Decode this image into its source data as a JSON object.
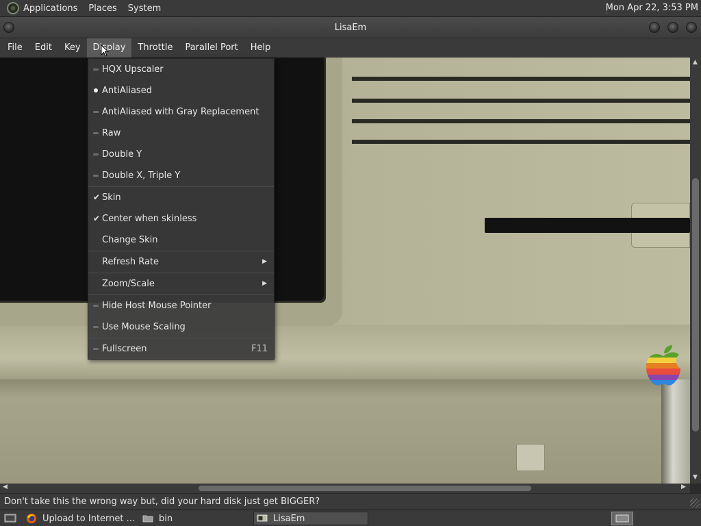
{
  "top_panel": {
    "menus": [
      "Applications",
      "Places",
      "System"
    ],
    "clock": "Mon Apr 22,  3:53 PM"
  },
  "window": {
    "title": "LisaEm"
  },
  "menubar": [
    "File",
    "Edit",
    "Key",
    "Display",
    "Throttle",
    "Parallel Port",
    "Help"
  ],
  "display_menu": {
    "items": [
      {
        "label": "HQX Upscaler",
        "mark": "dash"
      },
      {
        "label": "AntiAliased",
        "mark": "dot"
      },
      {
        "label": "AntiAliased with Gray Replacement",
        "mark": "dash"
      },
      {
        "label": "Raw",
        "mark": "dash"
      },
      {
        "label": "Double Y",
        "mark": "dash"
      },
      {
        "label": "Double X, Triple Y",
        "mark": "dash"
      },
      {
        "label": "Skin",
        "mark": "check"
      },
      {
        "label": "Center when skinless",
        "mark": "check"
      },
      {
        "label": "Change Skin",
        "mark": "none"
      },
      {
        "label": "Refresh Rate",
        "mark": "none",
        "submenu": true
      },
      {
        "label": "Zoom/Scale",
        "mark": "none",
        "submenu": true
      },
      {
        "label": "Hide Host Mouse Pointer",
        "mark": "dash"
      },
      {
        "label": "Use Mouse Scaling",
        "mark": "dash"
      },
      {
        "label": "Fullscreen",
        "mark": "dash",
        "accel": "F11"
      }
    ],
    "check_glyph": "✔",
    "submenu_glyph": "▶"
  },
  "status": {
    "message": "Don't take this the wrong way but, did your hard disk just get BIGGER?"
  },
  "taskbar": {
    "tasks": [
      {
        "label": "Upload to Internet ...",
        "icon": "firefox-icon"
      },
      {
        "label": "bin",
        "icon": "folder-icon"
      },
      {
        "label": "LisaEm",
        "icon": "lisa-app-icon"
      }
    ]
  },
  "colors": {
    "panel": "#3a3a3a",
    "menu_active": "#5b5b5b",
    "case_beige": "#b7b49a"
  }
}
